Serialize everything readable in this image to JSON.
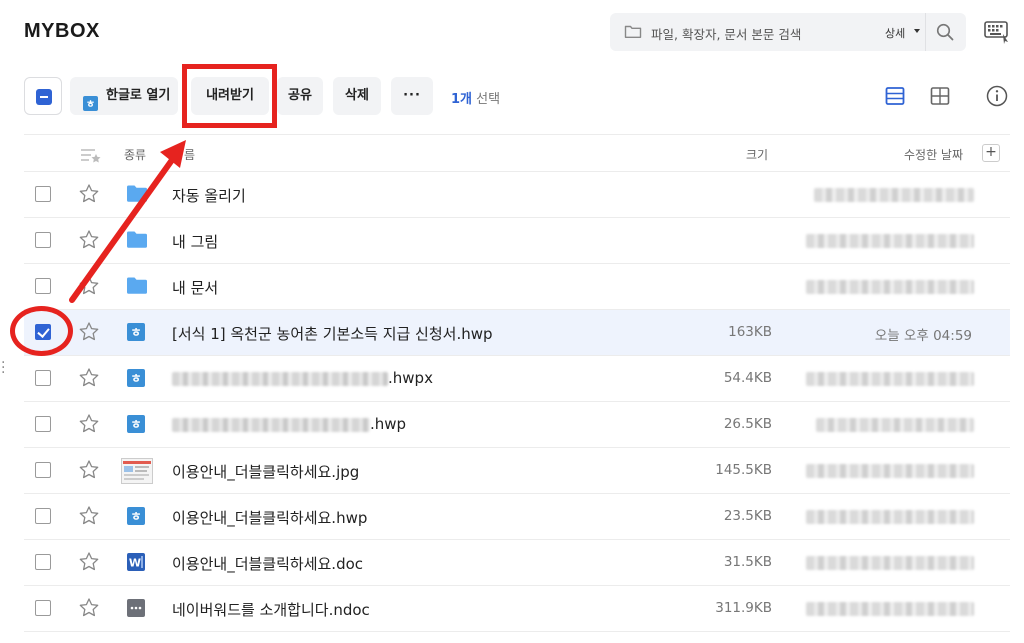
{
  "app": {
    "logo": "MYBOX"
  },
  "search": {
    "placeholder": "파일, 확장자, 문서 본문 검색",
    "detail_label": "상세"
  },
  "toolbar": {
    "open_hangul_label": "한글로 열기",
    "download_label": "내려받기",
    "share_label": "공유",
    "delete_label": "삭제",
    "more_label": "···",
    "selection_count": "1개",
    "selection_suffix": " 선택"
  },
  "table": {
    "headers": {
      "kind": "종류",
      "name": "름",
      "size": "크기",
      "date": "수정한 날짜",
      "add": "+"
    },
    "rows": [
      {
        "icon": "folder-icon",
        "name_visible": "자동 올리기",
        "size": "",
        "date": "",
        "selected": false
      },
      {
        "icon": "folder-icon",
        "name_visible": "내 그림",
        "size": "",
        "date": "",
        "selected": false
      },
      {
        "icon": "folder-icon",
        "name_visible": "내 문서",
        "size": "",
        "date": "",
        "selected": false
      },
      {
        "icon": "hwp-file-icon",
        "name_visible": "[서식 1] 옥천군 농어촌 기본소득 지급 신청서.hwp",
        "size": "163KB",
        "date": "오늘 오후 04:59",
        "selected": true
      },
      {
        "icon": "hwp-file-icon",
        "name_visible": ".hwpx",
        "size": "54.4KB",
        "date": "",
        "selected": false
      },
      {
        "icon": "hwp-file-icon",
        "name_visible": ".hwp",
        "size": "26.5KB",
        "date": "",
        "selected": false
      },
      {
        "icon": "image-file-icon",
        "name_visible": "이용안내_더블클릭하세요.jpg",
        "size": "145.5KB",
        "date": "",
        "selected": false
      },
      {
        "icon": "hwp-file-icon",
        "name_visible": "이용안내_더블클릭하세요.hwp",
        "size": "23.5KB",
        "date": "",
        "selected": false
      },
      {
        "icon": "word-file-icon",
        "name_visible": "이용안내_더블클릭하세요.doc",
        "size": "31.5KB",
        "date": "",
        "selected": false
      },
      {
        "icon": "ndoc-file-icon",
        "name_visible": "네이버워드를 소개합니다.ndoc",
        "size": "311.9KB",
        "date": "",
        "selected": false
      }
    ]
  },
  "colors": {
    "accent": "#2f63d4",
    "annotation_red": "#e6231f",
    "selected_row": "#eef3fd",
    "folder": "#5aa9f0"
  }
}
